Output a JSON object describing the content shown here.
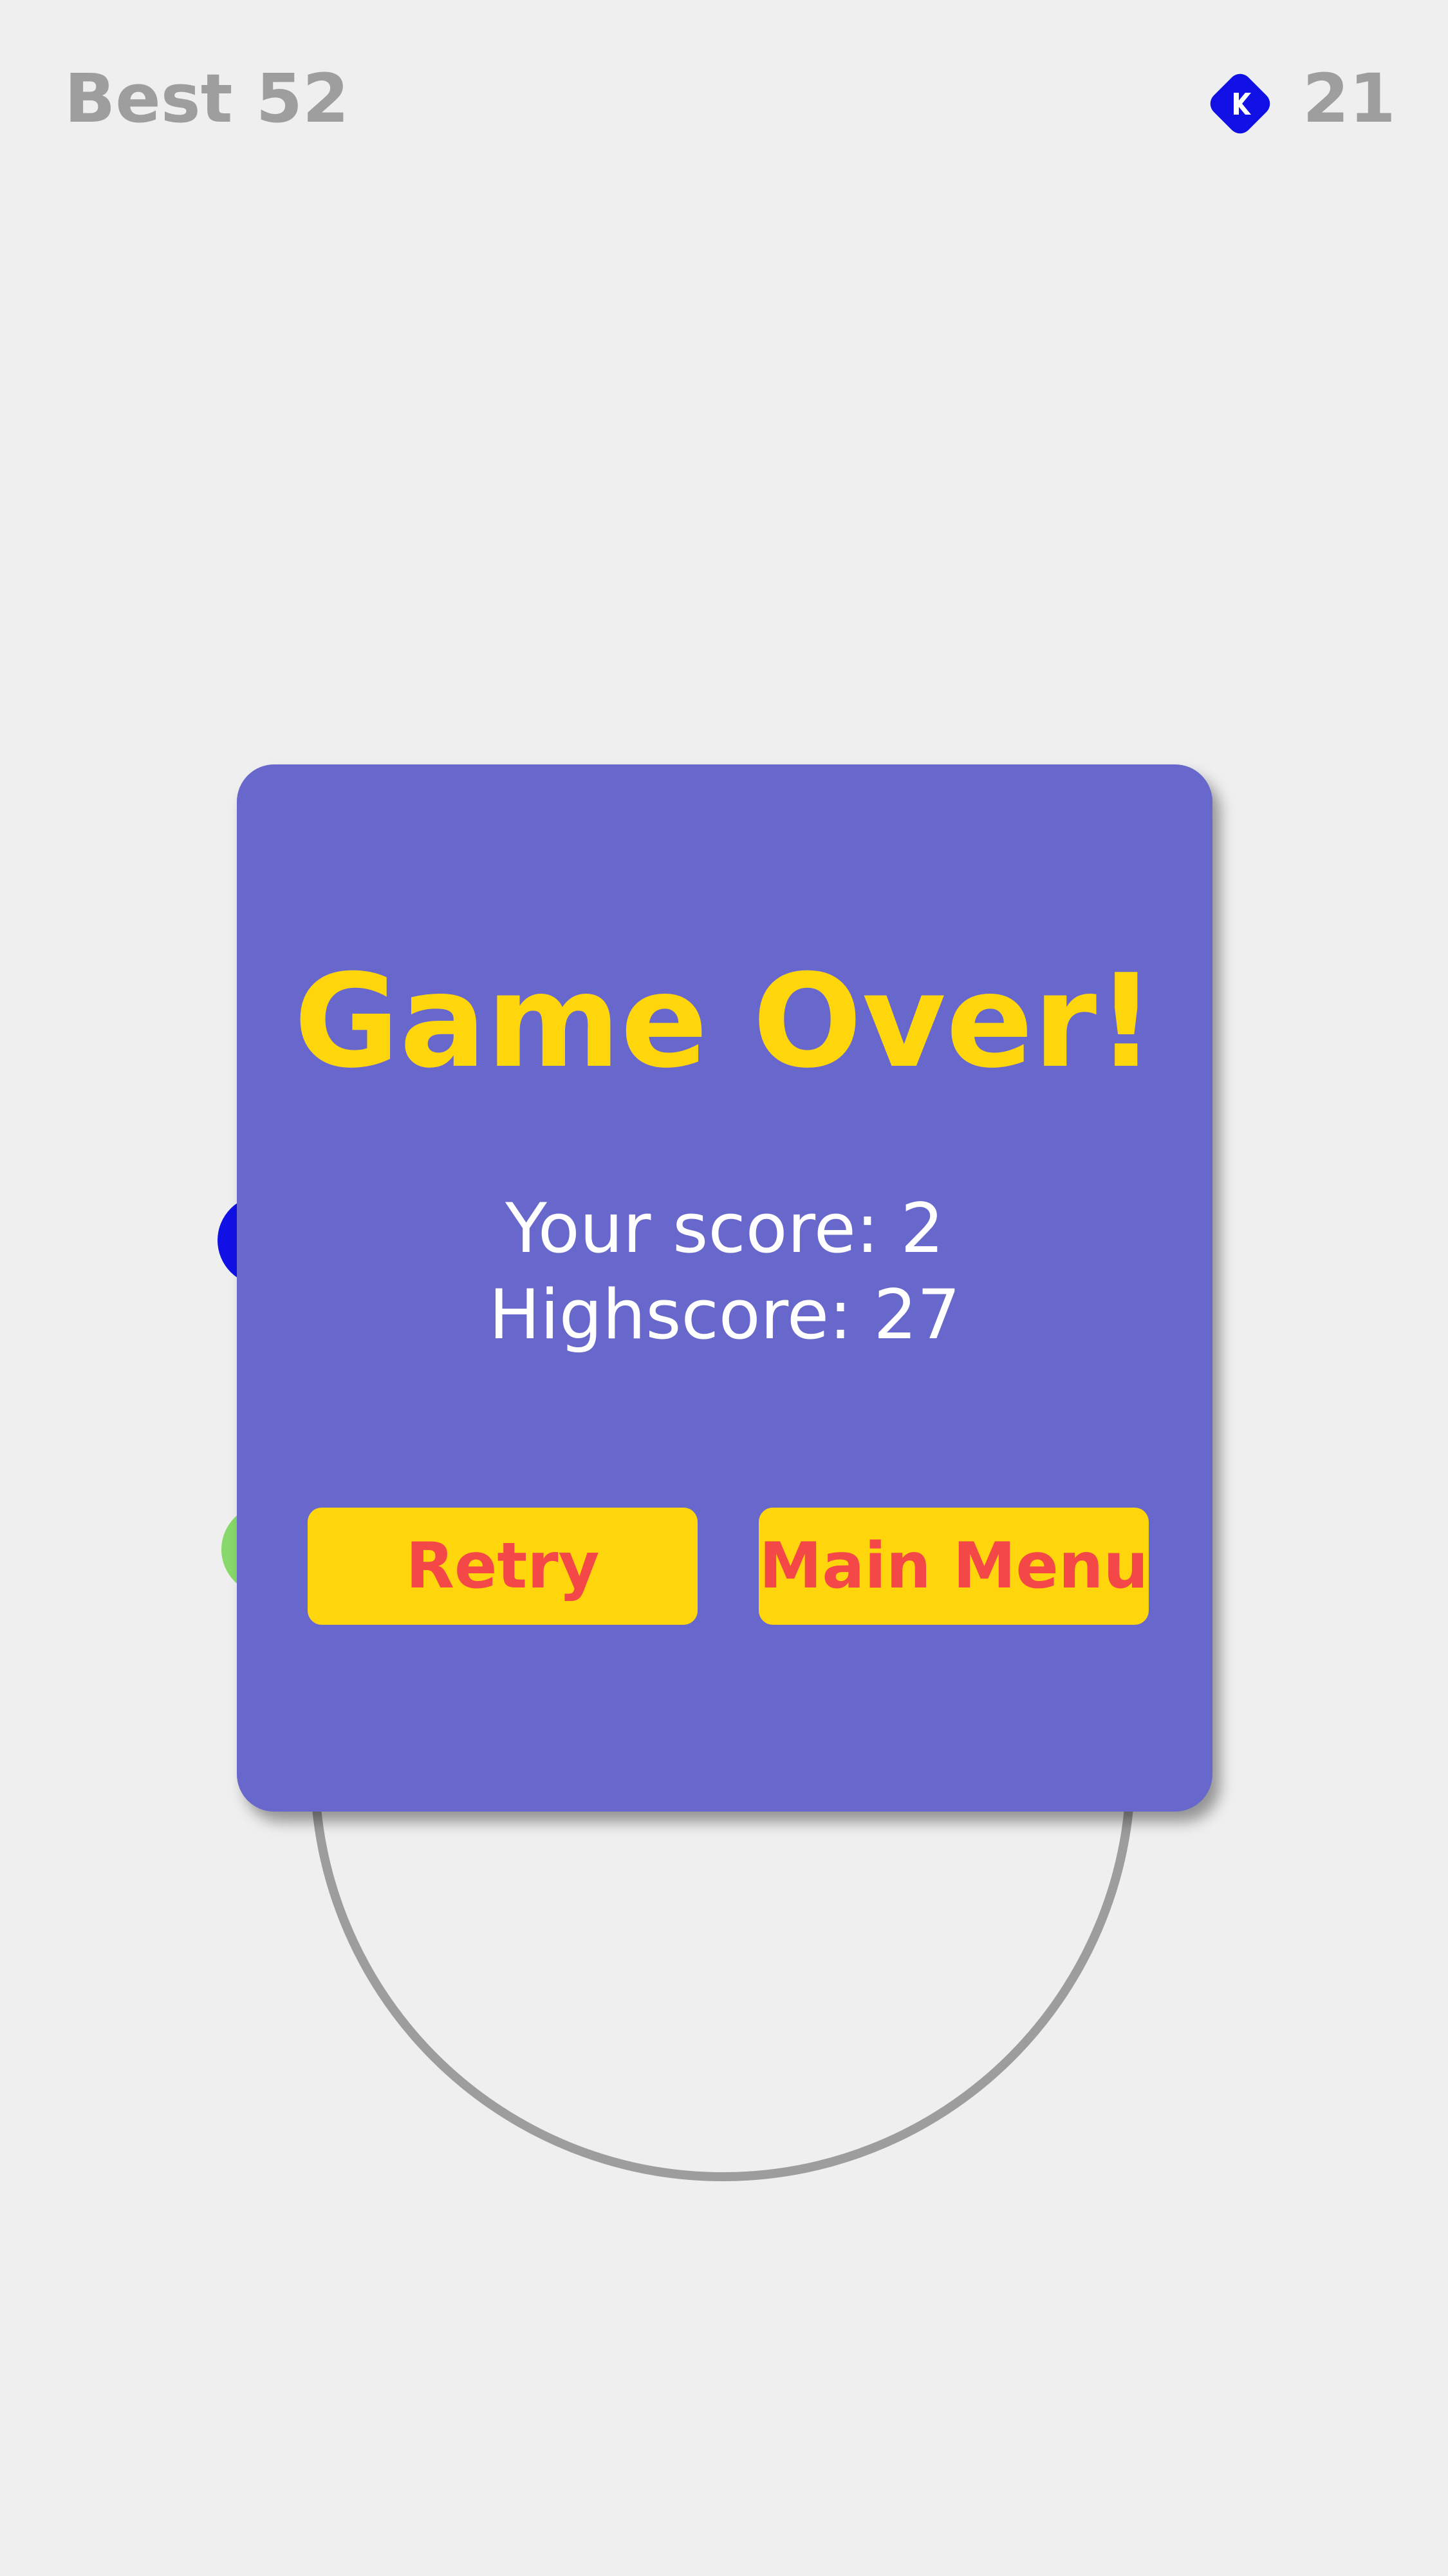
{
  "hud": {
    "best_text": "Best 52",
    "coins": "21",
    "coin_icon": "diamond-coin-icon"
  },
  "dialog": {
    "title": "Game Over!",
    "score_text": "Your score: 2",
    "highscore_text": "Highscore: 27",
    "retry_label": "Retry",
    "menu_label": "Main Menu"
  },
  "colors": {
    "background": "#efeff0",
    "dialog": "#6868cc",
    "title": "#ffd60c",
    "button": "#ffd60c",
    "button_text": "#f44747",
    "hud_text": "#9e9e9e",
    "coin": "#1111e6",
    "ring": "#9d9d9d",
    "ball_blue": "#1111e6",
    "ball_green": "#86d96a"
  }
}
